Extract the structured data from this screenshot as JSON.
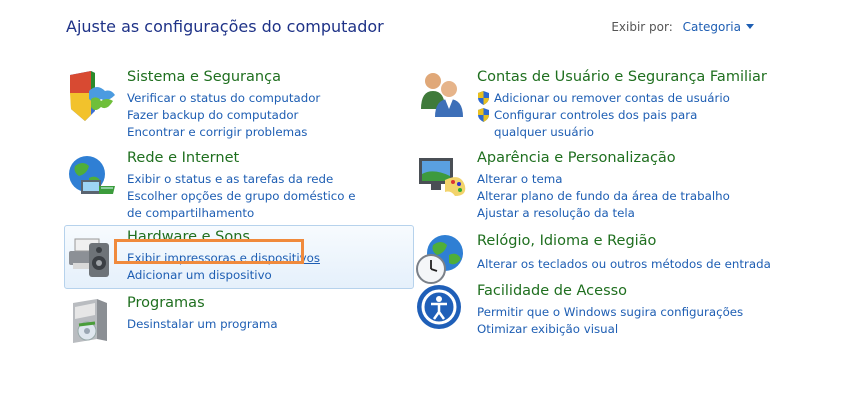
{
  "page": {
    "title": "Ajuste as configurações do computador"
  },
  "view_by": {
    "label": "Exibir por:",
    "value": "Categoria"
  },
  "categories": [
    {
      "title": "Sistema e Segurança",
      "icon": "shield-flag-icon",
      "links": [
        "Verificar o status do computador",
        "Fazer backup do computador",
        "Encontrar e corrigir problemas"
      ]
    },
    {
      "title": "Rede e Internet",
      "icon": "network-globe-icon",
      "links": [
        "Exibir o status e as tarefas da rede",
        "Escolher opções de grupo doméstico e de compartilhamento"
      ]
    },
    {
      "title": "Hardware e Sons",
      "icon": "printer-speaker-icon",
      "links": [
        "Exibir impressoras e dispositivos",
        "Adicionar um dispositivo"
      ]
    },
    {
      "title": "Programas",
      "icon": "programs-box-icon",
      "links": [
        "Desinstalar um programa"
      ]
    },
    {
      "title": "Contas de Usuário e Segurança Familiar",
      "icon": "users-icon",
      "links": [
        "Adicionar ou remover contas de usuário",
        "Configurar controles dos pais para qualquer usuário"
      ]
    },
    {
      "title": "Aparência e Personalização",
      "icon": "monitor-palette-icon",
      "links": [
        "Alterar o tema",
        "Alterar plano de fundo da área de trabalho",
        "Ajustar a resolução da tela"
      ]
    },
    {
      "title": "Relógio, Idioma e Região",
      "icon": "clock-globe-icon",
      "links": [
        "Alterar os teclados ou outros métodos de entrada"
      ]
    },
    {
      "title": "Facilidade de Acesso",
      "icon": "accessibility-icon",
      "links": [
        "Permitir que o Windows sugira configurações",
        "Otimizar exibição visual"
      ]
    }
  ],
  "colors": {
    "category_title": "#1f6f1f",
    "link": "#1e5eb3",
    "highlight": "#f08a3c"
  }
}
